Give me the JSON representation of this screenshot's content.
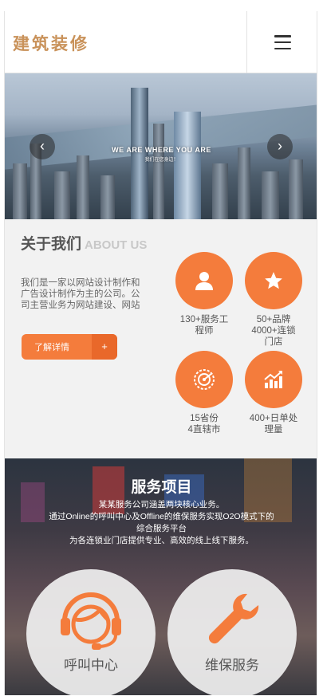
{
  "header": {
    "logo_text": "建筑装修",
    "menu_icon": "hamburger-icon"
  },
  "banner": {
    "headline": "WE ARE WHERE YOU ARE",
    "subline": "我们在您身边！",
    "prev_icon": "chevron-left-icon",
    "next_icon": "chevron-right-icon"
  },
  "about": {
    "title": "关于我们",
    "title_en": "ABOUT US",
    "description": "我们是一家以网站设计制作和广告设计制作为主的公司。公司主营业务为网站建设、网站",
    "more_label": "了解详情",
    "more_plus": "+",
    "stats": [
      {
        "icon": "person-icon",
        "line1": "130+服务工",
        "line2": "程师",
        "line3": ""
      },
      {
        "icon": "star-icon",
        "line1": "50+品牌",
        "line2": "4000+连锁",
        "line3": "门店"
      },
      {
        "icon": "radar-icon",
        "line1": "15省份",
        "line2": "4直辖市",
        "line3": ""
      },
      {
        "icon": "chart-up-icon",
        "line1": "400+日单处",
        "line2": "理量",
        "line3": ""
      }
    ]
  },
  "services": {
    "title": "服务项目",
    "desc_lines": [
      "某某服务公司涵盖两块核心业务。",
      "通过Online的呼叫中心及Offline的维保服务实现O2O模式下的",
      "综合服务平台",
      "为各连锁业门店提供专业、高效的线上线下服务。"
    ],
    "items": [
      {
        "icon": "headset-icon",
        "label": "呼叫中心"
      },
      {
        "icon": "wrench-icon",
        "label": "维保服务"
      }
    ]
  },
  "colors": {
    "accent": "#f47c3c",
    "accent_dark": "#e9682a",
    "logo": "#c9925a"
  }
}
